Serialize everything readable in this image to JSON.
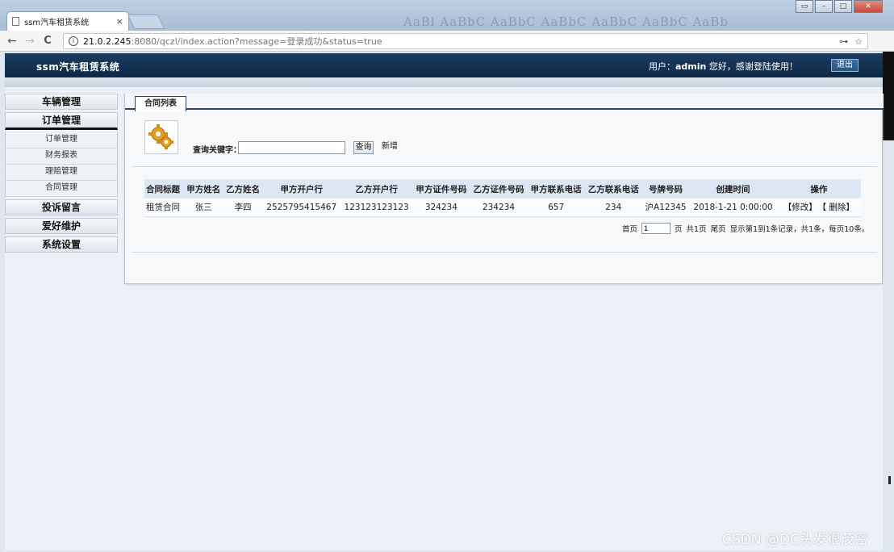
{
  "browser": {
    "tab_title": "ssm汽车租赁系统",
    "tab_close": "×",
    "url_host": "21.0.2.245",
    "url_path": ":8080/qczl/index.action?message=登录成功&status=true",
    "ribbon_ghost": "AaBl AaBbC AaBbC AaBbC AaBbC AaBbC AaBb",
    "nav_back": "←",
    "nav_forward": "→",
    "nav_reload": "C",
    "info_glyph": "i",
    "key_glyph": "⊶",
    "star_glyph": "☆"
  },
  "header": {
    "system_title": "ssm汽车租赁系统",
    "user_prefix": "用户：",
    "username": "admin",
    "welcome": " 您好，感谢登陆使用！",
    "logout_label": "退出"
  },
  "sidebar": {
    "menus": [
      {
        "label": "车辆管理"
      },
      {
        "label": "订单管理"
      }
    ],
    "sub_items": [
      "订单管理",
      "财务报表",
      "理赔管理",
      "合同管理"
    ],
    "menus_after": [
      {
        "label": "投诉留言"
      },
      {
        "label": "爱好维护"
      },
      {
        "label": "系统设置"
      }
    ]
  },
  "main": {
    "tab_label": "合同列表",
    "search_label": "查询关键字：",
    "search_value": "",
    "search_button": "查询",
    "add_button": "新增",
    "columns": [
      "合同标题",
      "甲方姓名",
      "乙方姓名",
      "甲方开户行",
      "乙方开户行",
      "甲方证件号码",
      "乙方证件号码",
      "甲方联系电话",
      "乙方联系电话",
      "号牌号码",
      "创建时间",
      "操作"
    ],
    "rows": [
      {
        "title": "租赁合同",
        "party_a": "张三",
        "party_b": "李四",
        "bank_a": "2525795415467",
        "bank_b": "123123123123",
        "id_a": "324234",
        "id_b": "234234",
        "phone_a": "657",
        "phone_b": "234",
        "plate": "沪A12345",
        "created": "2018-1-21 0:00:00",
        "edit": "【修改】",
        "delete": "【 删除】"
      }
    ],
    "pager": {
      "first": "首页",
      "page_value": "1",
      "page_suffix": "页",
      "total_pages": "共1页",
      "last": "尾页",
      "summary": "显示第1到1条记录，共1条，每页10条。"
    }
  },
  "watermark": "CSDN @DC头发很茂密",
  "colors": {
    "header_bg": "#0e2947",
    "tab_border": "#27456b",
    "grid_header": "#dde7f3"
  }
}
